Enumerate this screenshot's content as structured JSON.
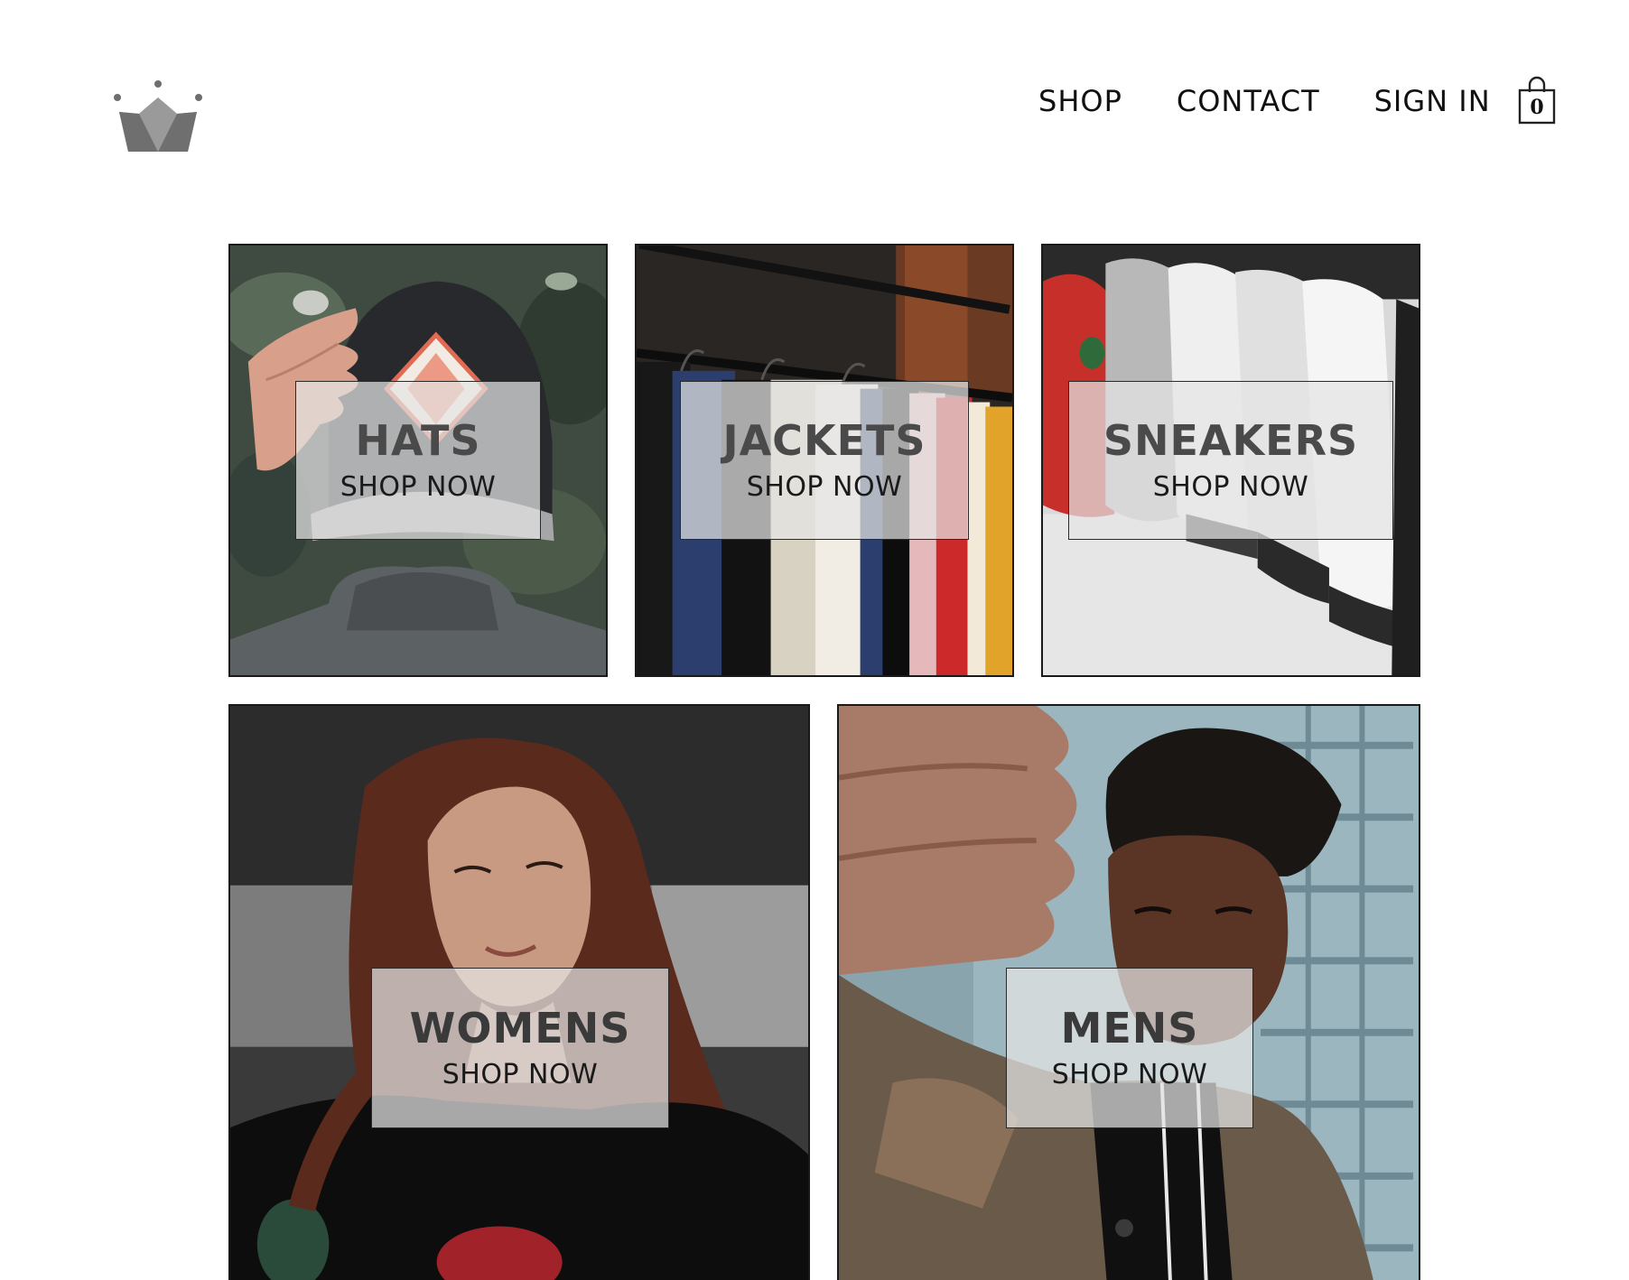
{
  "header": {
    "logo_icon": "crown-icon",
    "nav": {
      "shop": "SHOP",
      "contact": "CONTACT",
      "sign_in": "SIGN IN"
    },
    "cart": {
      "icon": "shopping-bag-icon",
      "count": "0"
    }
  },
  "directory": {
    "hats": {
      "title": "HATS",
      "subtitle": "SHOP NOW"
    },
    "jackets": {
      "title": "JACKETS",
      "subtitle": "SHOP NOW"
    },
    "sneakers": {
      "title": "SNEAKERS",
      "subtitle": "SHOP NOW"
    },
    "womens": {
      "title": "WOMENS",
      "subtitle": "SHOP NOW"
    },
    "mens": {
      "title": "MENS",
      "subtitle": "SHOP NOW"
    }
  },
  "colors": {
    "logo_gray": "#7a7a7a",
    "text": "#111111",
    "overlay": "#e4e4e4",
    "border": "#1a1a1a"
  }
}
